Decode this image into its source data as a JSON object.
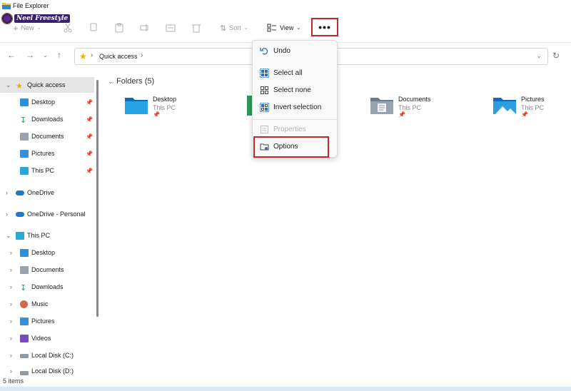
{
  "window": {
    "title": "File Explorer"
  },
  "watermark": {
    "text": "Neel Freestyle"
  },
  "toolbar": {
    "new_label": "New",
    "sort_label": "Sort",
    "view_label": "View",
    "more_label": "•••"
  },
  "address": {
    "crumb": "Quick access",
    "sep": "›"
  },
  "sidebar": {
    "items": [
      {
        "label": "Quick access",
        "icon": "star-icon"
      },
      {
        "label": "Desktop",
        "icon": "desktop-icon"
      },
      {
        "label": "Downloads",
        "icon": "download-icon"
      },
      {
        "label": "Documents",
        "icon": "documents-icon"
      },
      {
        "label": "Pictures",
        "icon": "pictures-icon"
      },
      {
        "label": "This PC",
        "icon": "computer-icon"
      },
      {
        "label": "OneDrive",
        "icon": "cloud-icon"
      },
      {
        "label": "OneDrive - Personal",
        "icon": "cloud-icon"
      },
      {
        "label": "This PC",
        "icon": "computer-icon"
      },
      {
        "label": "Desktop",
        "icon": "desktop-icon"
      },
      {
        "label": "Documents",
        "icon": "documents-icon"
      },
      {
        "label": "Downloads",
        "icon": "download-icon"
      },
      {
        "label": "Music",
        "icon": "music-icon"
      },
      {
        "label": "Pictures",
        "icon": "pictures-icon"
      },
      {
        "label": "Videos",
        "icon": "videos-icon"
      },
      {
        "label": "Local Disk (C:)",
        "icon": "drive-icon"
      },
      {
        "label": "Local Disk (D:)",
        "icon": "drive-icon"
      }
    ]
  },
  "main": {
    "folders_header": "Folders (5)",
    "folders": [
      {
        "name": "Desktop",
        "location": "This PC"
      },
      {
        "name": "Documents",
        "location": "This PC"
      },
      {
        "name": "Pictures",
        "location": "This PC"
      }
    ]
  },
  "menu": {
    "items": [
      {
        "label": "Undo",
        "icon": "undo-icon",
        "disabled": false
      },
      {
        "label": "Select all",
        "icon": "select-all-icon",
        "disabled": false
      },
      {
        "label": "Select none",
        "icon": "select-none-icon",
        "disabled": false
      },
      {
        "label": "Invert selection",
        "icon": "invert-selection-icon",
        "disabled": false
      },
      {
        "label": "Properties",
        "icon": "properties-icon",
        "disabled": true
      },
      {
        "label": "Options",
        "icon": "options-icon",
        "disabled": false
      }
    ]
  },
  "status": {
    "items_count": "5 items"
  },
  "colors": {
    "highlight": "#c1272d",
    "folder_blue": "#1e88d6",
    "selected_bg": "#e5e5e5"
  }
}
